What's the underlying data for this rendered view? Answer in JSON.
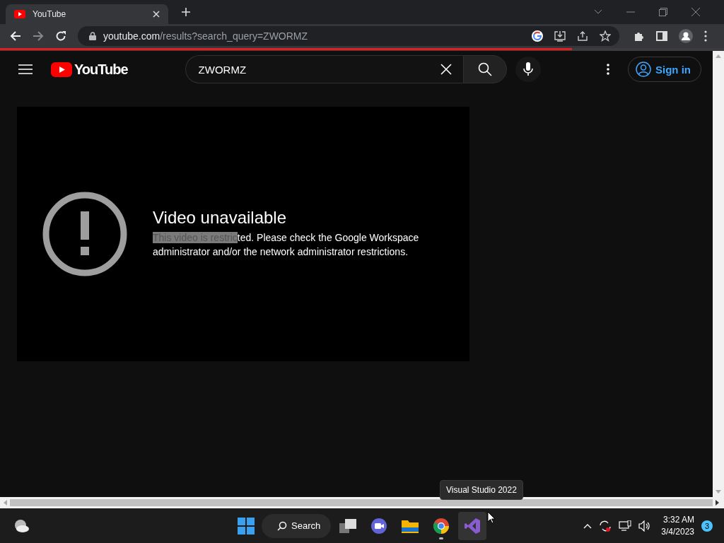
{
  "browser": {
    "tab": {
      "title": "YouTube",
      "selected": true
    },
    "url": {
      "host": "youtube.com",
      "path": "/results?search_query=ZWORMZ"
    },
    "page_load": {
      "level": 0.79
    }
  },
  "header": {
    "logo": "YouTube",
    "search": {
      "value": "ZWORMZ"
    },
    "sign_in": "Sign in"
  },
  "player": {
    "title": "Video unavailable",
    "message": {
      "selected_text": "This video is restric",
      "text": "ted. Please check the Google Workspace administrator and/or the network administrator restrictions."
    }
  },
  "tooltip": "Visual Studio 2022",
  "taskbar": {
    "search": "Search",
    "apps": [
      {
        "kind": "task-view",
        "running": false,
        "hovered": false
      },
      {
        "kind": "chat",
        "running": false,
        "hovered": false
      },
      {
        "kind": "explorer",
        "running": false,
        "hovered": false
      },
      {
        "kind": "chrome",
        "running": true,
        "hovered": false
      },
      {
        "kind": "visual-studio",
        "running": false,
        "hovered": true
      }
    ],
    "clock": {
      "time": "3:32 AM",
      "date": "3/4/2023"
    },
    "notifications": "3"
  }
}
